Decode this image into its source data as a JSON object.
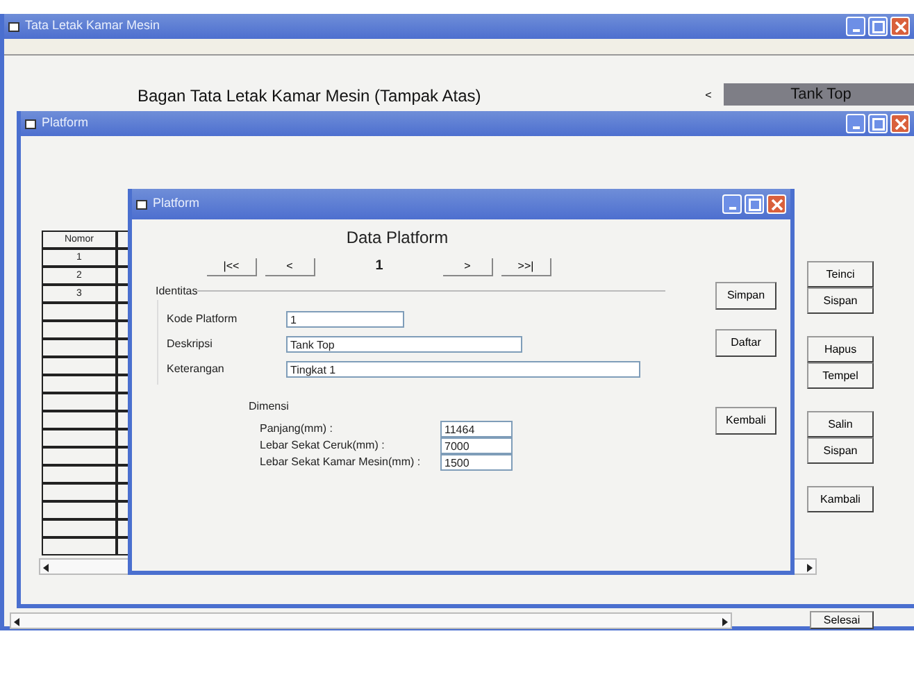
{
  "main_window": {
    "title": "Tata Letak Kamar Mesin",
    "heading": "Bagan Tata Letak Kamar Mesin (Tampak Atas)",
    "prev_button": "<",
    "selection": "Tank Top",
    "finish_button": "Selesai"
  },
  "platform_window": {
    "title": "Platform",
    "table": {
      "columns": [
        "Nomor"
      ],
      "rows": [
        "1",
        "2",
        "3"
      ]
    },
    "buttons": [
      "Teinci",
      "Sispan",
      "Hapus",
      "Tempel",
      "Salin",
      "Sispan",
      "Kambali"
    ]
  },
  "dialog": {
    "title": "Platform",
    "heading": "Data Platform",
    "navigation": [
      {
        "kind": "button",
        "label": "|<<"
      },
      {
        "kind": "button",
        "label": "<"
      },
      {
        "kind": "record",
        "label": "1"
      },
      {
        "kind": "button",
        "label": ">"
      },
      {
        "kind": "button",
        "label": ">>|"
      }
    ],
    "identity": {
      "title": "Identitas",
      "fields": [
        {
          "label": "Kode Platform",
          "value": "1"
        },
        {
          "label": "Deskripsi",
          "value": "Tank Top"
        },
        {
          "label": "Keterangan",
          "value": "Tingkat 1"
        }
      ]
    },
    "dimensions": {
      "title": "Dimensi",
      "fields": [
        {
          "label": "Panjang(mm) :",
          "value": "11464"
        },
        {
          "label": "Lebar Sekat Ceruk(mm) :",
          "value": "7000"
        },
        {
          "label": "Lebar Sekat Kamar Mesin(mm) :",
          "value": "1500"
        }
      ]
    },
    "buttons": [
      "Simpan",
      "Daftar",
      "Kembali"
    ]
  }
}
